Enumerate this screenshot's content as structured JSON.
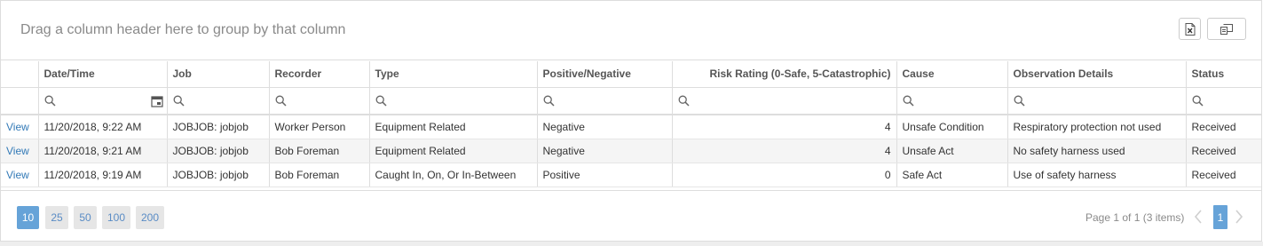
{
  "group_panel": {
    "text": "Drag a column header here to group by that column"
  },
  "toolbar": {
    "export_icon": "excel-export-icon",
    "chooser_icon": "column-chooser-icon"
  },
  "columns": [
    {
      "label": ""
    },
    {
      "label": "Date/Time"
    },
    {
      "label": "Job"
    },
    {
      "label": "Recorder"
    },
    {
      "label": "Type"
    },
    {
      "label": "Positive/Negative"
    },
    {
      "label": "Risk Rating (0-Safe, 5-Catastrophic)"
    },
    {
      "label": "Cause"
    },
    {
      "label": "Observation Details"
    },
    {
      "label": "Status"
    }
  ],
  "rows": [
    {
      "action": "View",
      "datetime": "11/20/2018, 9:22 AM",
      "job": "JOBJOB: jobjob",
      "recorder": "Worker Person",
      "type": "Equipment Related",
      "posneg": "Negative",
      "risk": "4",
      "cause": "Unsafe Condition",
      "details": "Respiratory protection not used",
      "status": "Received"
    },
    {
      "action": "View",
      "datetime": "11/20/2018, 9:21 AM",
      "job": "JOBJOB: jobjob",
      "recorder": "Bob Foreman",
      "type": "Equipment Related",
      "posneg": "Negative",
      "risk": "4",
      "cause": "Unsafe Act",
      "details": "No safety harness used",
      "status": "Received"
    },
    {
      "action": "View",
      "datetime": "11/20/2018, 9:19 AM",
      "job": "JOBJOB: jobjob",
      "recorder": "Bob Foreman",
      "type": "Caught In, On, Or In-Between",
      "posneg": "Positive",
      "risk": "0",
      "cause": "Safe Act",
      "details": "Use of safety harness",
      "status": "Received"
    }
  ],
  "pager": {
    "page_sizes": [
      "10",
      "25",
      "50",
      "100",
      "200"
    ],
    "selected_page_size": "10",
    "info": "Page 1 of 1 (3 items)",
    "current_page": "1"
  },
  "colors": {
    "accent": "#66a3d8",
    "link": "#337ab7",
    "border": "#dddddd",
    "alt_row": "#f5f5f5"
  }
}
